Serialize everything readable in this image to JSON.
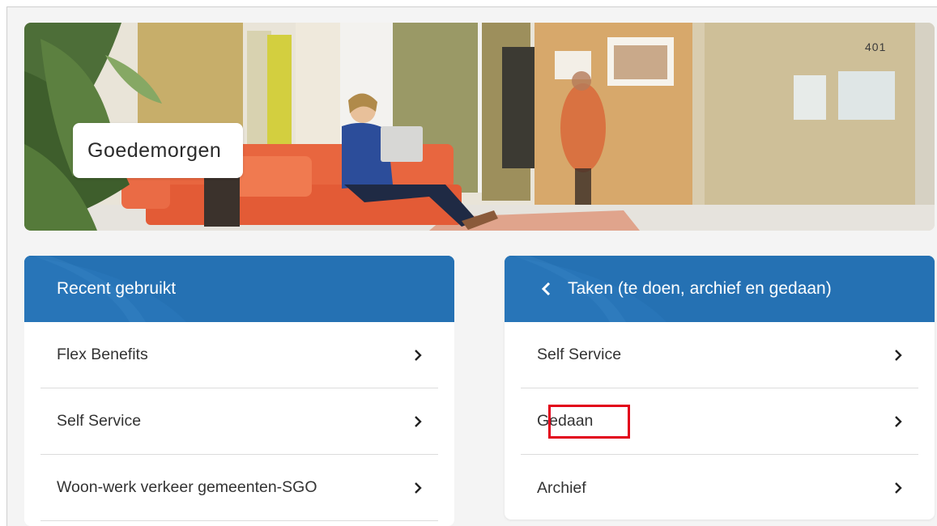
{
  "hero": {
    "greeting": "Goedemorgen",
    "door_number": "401"
  },
  "recent": {
    "title": "Recent gebruikt",
    "items": [
      {
        "label": "Flex Benefits"
      },
      {
        "label": "Self Service"
      },
      {
        "label": "Woon-werk verkeer gemeenten-SGO"
      }
    ]
  },
  "tasks": {
    "title": "Taken (te doen, archief en gedaan)",
    "items": [
      {
        "label": "Self Service"
      },
      {
        "label": "Gedaan",
        "highlighted": true
      },
      {
        "label": "Archief"
      }
    ]
  },
  "colors": {
    "header_blue": "#2571b3",
    "highlight_red": "#e2001a",
    "sofa_orange": "#e8663f"
  },
  "icons": {
    "back": "chevron-left-icon",
    "row_arrow": "chevron-right-icon"
  }
}
